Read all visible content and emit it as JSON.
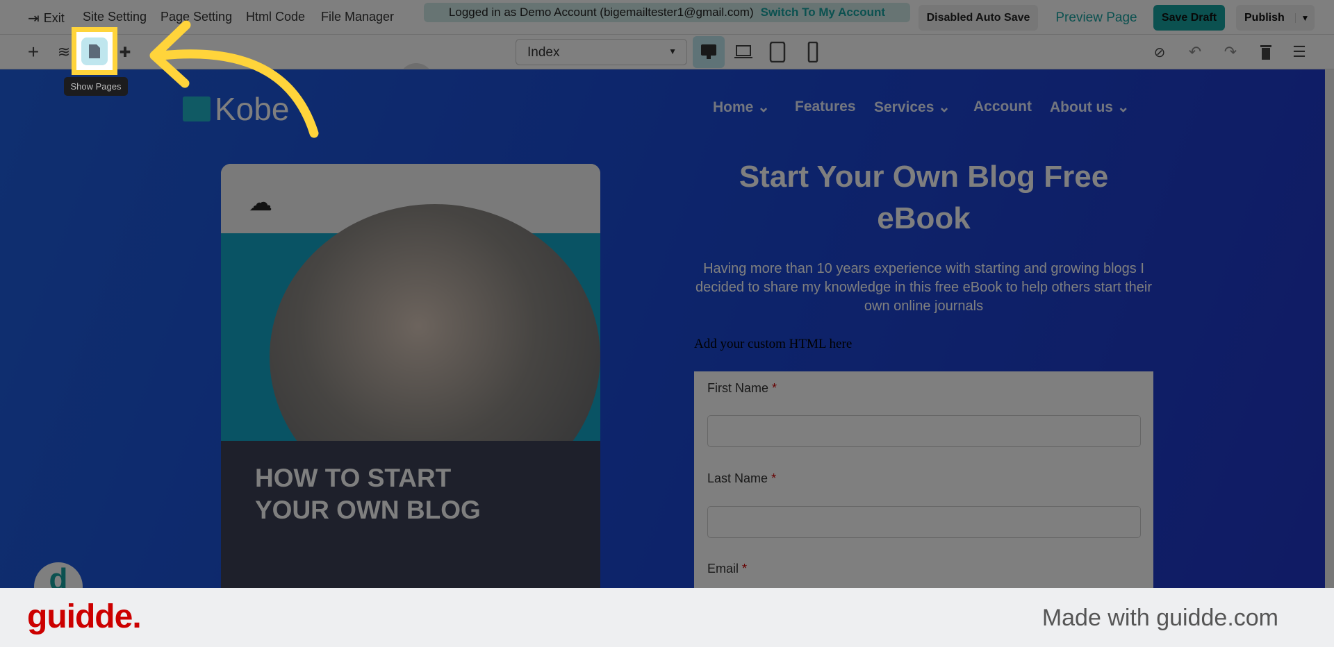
{
  "topbar": {
    "menu": [
      "Exit",
      "Site Setting",
      "Page Setting",
      "Html Code",
      "File Manager"
    ],
    "login_text": "Logged in as Demo Account (bigemailtester1@gmail.com)",
    "switch_label": "Switch To My Account",
    "auto_save": "Disabled Auto Save",
    "preview": "Preview Page",
    "save_draft": "Save Draft",
    "publish": "Publish"
  },
  "toolbar": {
    "page_select": "Index",
    "tooltip": "Show Pages"
  },
  "site": {
    "logo": "Kobe",
    "nav": [
      "Home",
      "Features",
      "Services",
      "Account",
      "About us"
    ],
    "title": "Start Your Own Blog Free eBook",
    "description": "Having more than 10 years experience with starting and growing blogs I decided to share my knowledge in this free eBook to help others start their own online journals",
    "custom_html": "Add your custom HTML here",
    "card_title_1": "HOW TO START",
    "card_title_2": "YOUR OWN BLOG",
    "form": {
      "first_name": "First Name",
      "last_name": "Last Name",
      "email": "Email",
      "required": "*"
    }
  },
  "footer": {
    "brand": "guidde.",
    "made_with": "Made with guidde.com"
  },
  "colors": {
    "accent": "#17a2a0",
    "highlight": "#ffd43b",
    "brand_red": "#cc0000"
  }
}
